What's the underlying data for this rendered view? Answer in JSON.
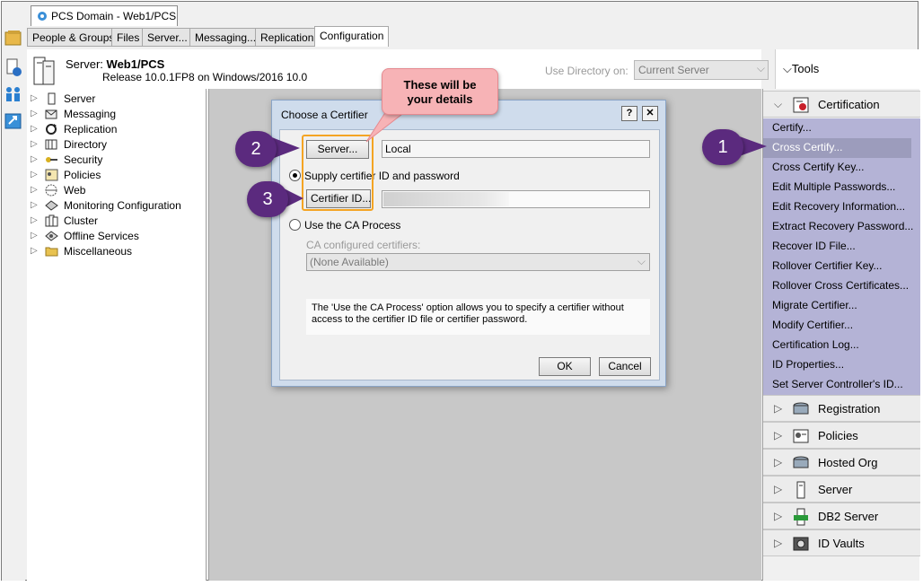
{
  "window_tab": {
    "title": "PCS Domain - Web1/PCS..."
  },
  "tabs": [
    {
      "label": "People & Groups"
    },
    {
      "label": "Files"
    },
    {
      "label": "Server..."
    },
    {
      "label": "Messaging..."
    },
    {
      "label": "Replication"
    },
    {
      "label": "Configuration",
      "active": true
    }
  ],
  "server_header": {
    "label": "Server:",
    "name": "Web1/PCS",
    "release": "Release 10.0.1FP8 on Windows/2016 10.0",
    "use_directory_label": "Use Directory on:",
    "use_directory_value": "Current Server"
  },
  "tools_header": {
    "label": "Tools"
  },
  "tree": [
    {
      "label": "Server",
      "icon": "server-icon"
    },
    {
      "label": "Messaging",
      "icon": "messaging-icon"
    },
    {
      "label": "Replication",
      "icon": "replication-icon"
    },
    {
      "label": "Directory",
      "icon": "directory-icon"
    },
    {
      "label": "Security",
      "icon": "key-icon"
    },
    {
      "label": "Policies",
      "icon": "policies-icon"
    },
    {
      "label": "Web",
      "icon": "web-icon"
    },
    {
      "label": "Monitoring Configuration",
      "icon": "monitoring-icon"
    },
    {
      "label": "Cluster",
      "icon": "cluster-icon"
    },
    {
      "label": "Offline Services",
      "icon": "offline-services-icon"
    },
    {
      "label": "Miscellaneous",
      "icon": "folder-icon"
    }
  ],
  "tools_panel": {
    "certification": {
      "label": "Certification",
      "items": [
        {
          "label": "Certify..."
        },
        {
          "label": "Cross Certify...",
          "selected": true
        },
        {
          "label": "Cross Certify Key..."
        },
        {
          "label": "Edit Multiple Passwords..."
        },
        {
          "label": "Edit Recovery Information..."
        },
        {
          "label": "Extract Recovery Password..."
        },
        {
          "label": "Recover ID File..."
        },
        {
          "label": "Rollover Certifier Key..."
        },
        {
          "label": "Rollover Cross Certificates..."
        },
        {
          "label": "Migrate Certifier..."
        },
        {
          "label": "Modify Certifier..."
        },
        {
          "label": "Certification Log..."
        },
        {
          "label": "ID Properties..."
        },
        {
          "label": "Set Server Controller's ID..."
        }
      ]
    },
    "categories": [
      {
        "label": "Registration",
        "icon": "registration-icon"
      },
      {
        "label": "Policies",
        "icon": "policies-icon"
      },
      {
        "label": "Hosted Org",
        "icon": "hosted-org-icon"
      },
      {
        "label": "Server",
        "icon": "server-icon"
      },
      {
        "label": "DB2 Server",
        "icon": "db2-server-icon"
      },
      {
        "label": "ID Vaults",
        "icon": "id-vaults-icon"
      }
    ]
  },
  "dialog": {
    "title": "Choose a Certifier",
    "help_label": "?",
    "close_label": "✕",
    "server_button": "Server...",
    "server_value": "Local",
    "supply_option": "Supply certifier ID and password",
    "certifier_id_button": "Certifier ID...",
    "ca_option": "Use the CA Process",
    "ca_certifiers_label": "CA configured certifiers:",
    "ca_certifiers_value": "(None Available)",
    "info_text_line1": "The 'Use the CA Process' option allows you to specify a certifier without",
    "info_text_line2": "access to the certifier ID file or certifier password.",
    "ok": "OK",
    "cancel": "Cancel"
  },
  "annotations": {
    "callout_line1": "These will be",
    "callout_line2": "your details",
    "badge1": "1",
    "badge2": "2",
    "badge3": "3"
  },
  "colors": {
    "cert_list_bg": "#b4b3d6",
    "cert_selected_bg": "#9c9cbc",
    "badge": "#5b2a7e",
    "callout": "#f7b3b6",
    "highlight": "#f4a423"
  }
}
